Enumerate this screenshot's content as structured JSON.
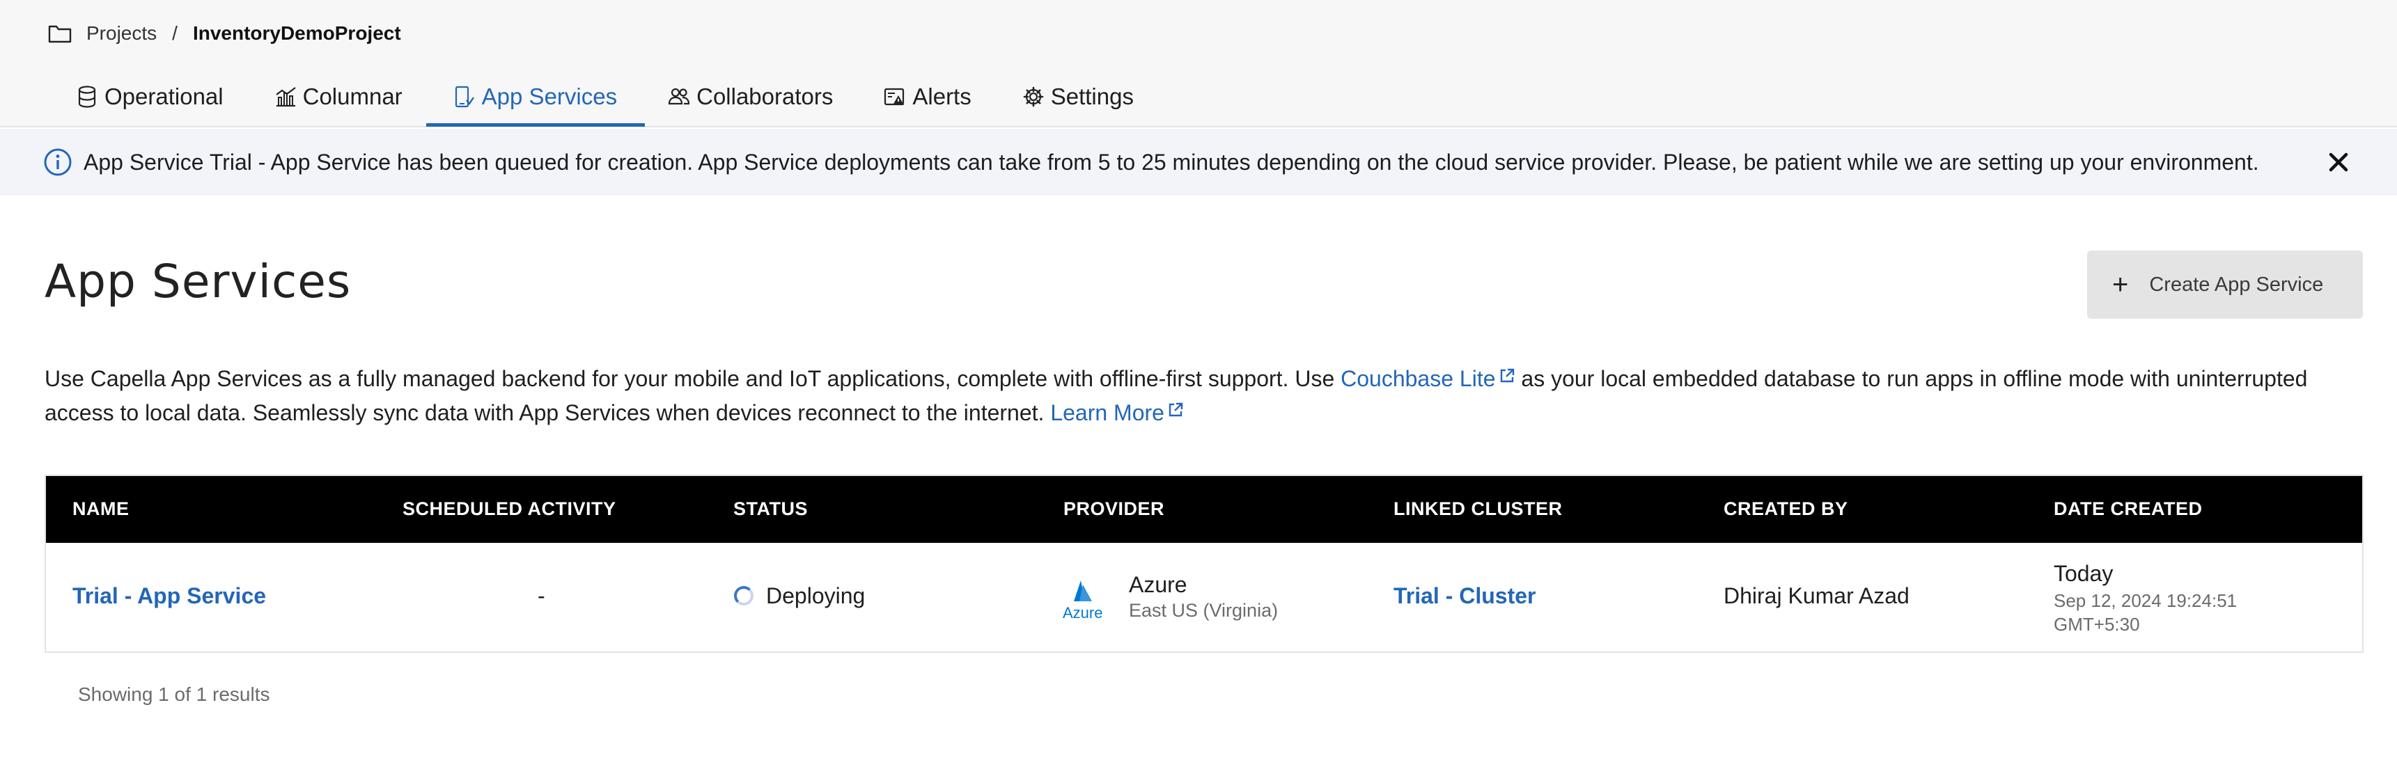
{
  "breadcrumb": {
    "root": "Projects",
    "separator": "/",
    "current": "InventoryDemoProject"
  },
  "tabs": [
    {
      "label": "Operational",
      "icon": "database-icon"
    },
    {
      "label": "Columnar",
      "icon": "chart-icon"
    },
    {
      "label": "App Services",
      "icon": "app-services-icon",
      "active": true
    },
    {
      "label": "Collaborators",
      "icon": "users-icon"
    },
    {
      "label": "Alerts",
      "icon": "alert-icon"
    },
    {
      "label": "Settings",
      "icon": "gear-icon"
    }
  ],
  "banner": {
    "message": "App Service Trial - App Service has been queued for creation. App Service deployments can take from 5 to 25 minutes depending on the cloud service provider. Please, be patient while we are setting up your environment."
  },
  "page": {
    "title": "App Services",
    "create_button": "Create App Service",
    "description_part1": "Use Capella App Services as a fully managed backend for your mobile and IoT applications, complete with offline-first support. Use ",
    "couchbase_lite_link": "Couchbase Lite",
    "description_part2": " as your local embedded database to run apps in offline mode with uninterrupted access to local data. Seamlessly sync data with App Services when devices reconnect to the internet. ",
    "learn_more_link": "Learn More"
  },
  "table": {
    "headers": [
      "NAME",
      "SCHEDULED ACTIVITY",
      "STATUS",
      "PROVIDER",
      "LINKED CLUSTER",
      "CREATED BY",
      "DATE CREATED"
    ],
    "rows": [
      {
        "name": "Trial - App Service",
        "scheduled_activity": "-",
        "status": "Deploying",
        "provider": "Azure",
        "provider_logo_text": "Azure",
        "region": "East US (Virginia)",
        "linked_cluster": "Trial - Cluster",
        "created_by": "Dhiraj Kumar Azad",
        "date_created_relative": "Today",
        "date_created_full": "Sep 12, 2024 19:24:51",
        "date_created_tz": "GMT+5:30"
      }
    ]
  },
  "footer": {
    "results": "Showing 1 of 1 results"
  },
  "colors": {
    "accent": "#2366b8",
    "header_bg": "#000000",
    "banner_bg": "#f2f4f9",
    "azure_blue": "#0078d4"
  }
}
